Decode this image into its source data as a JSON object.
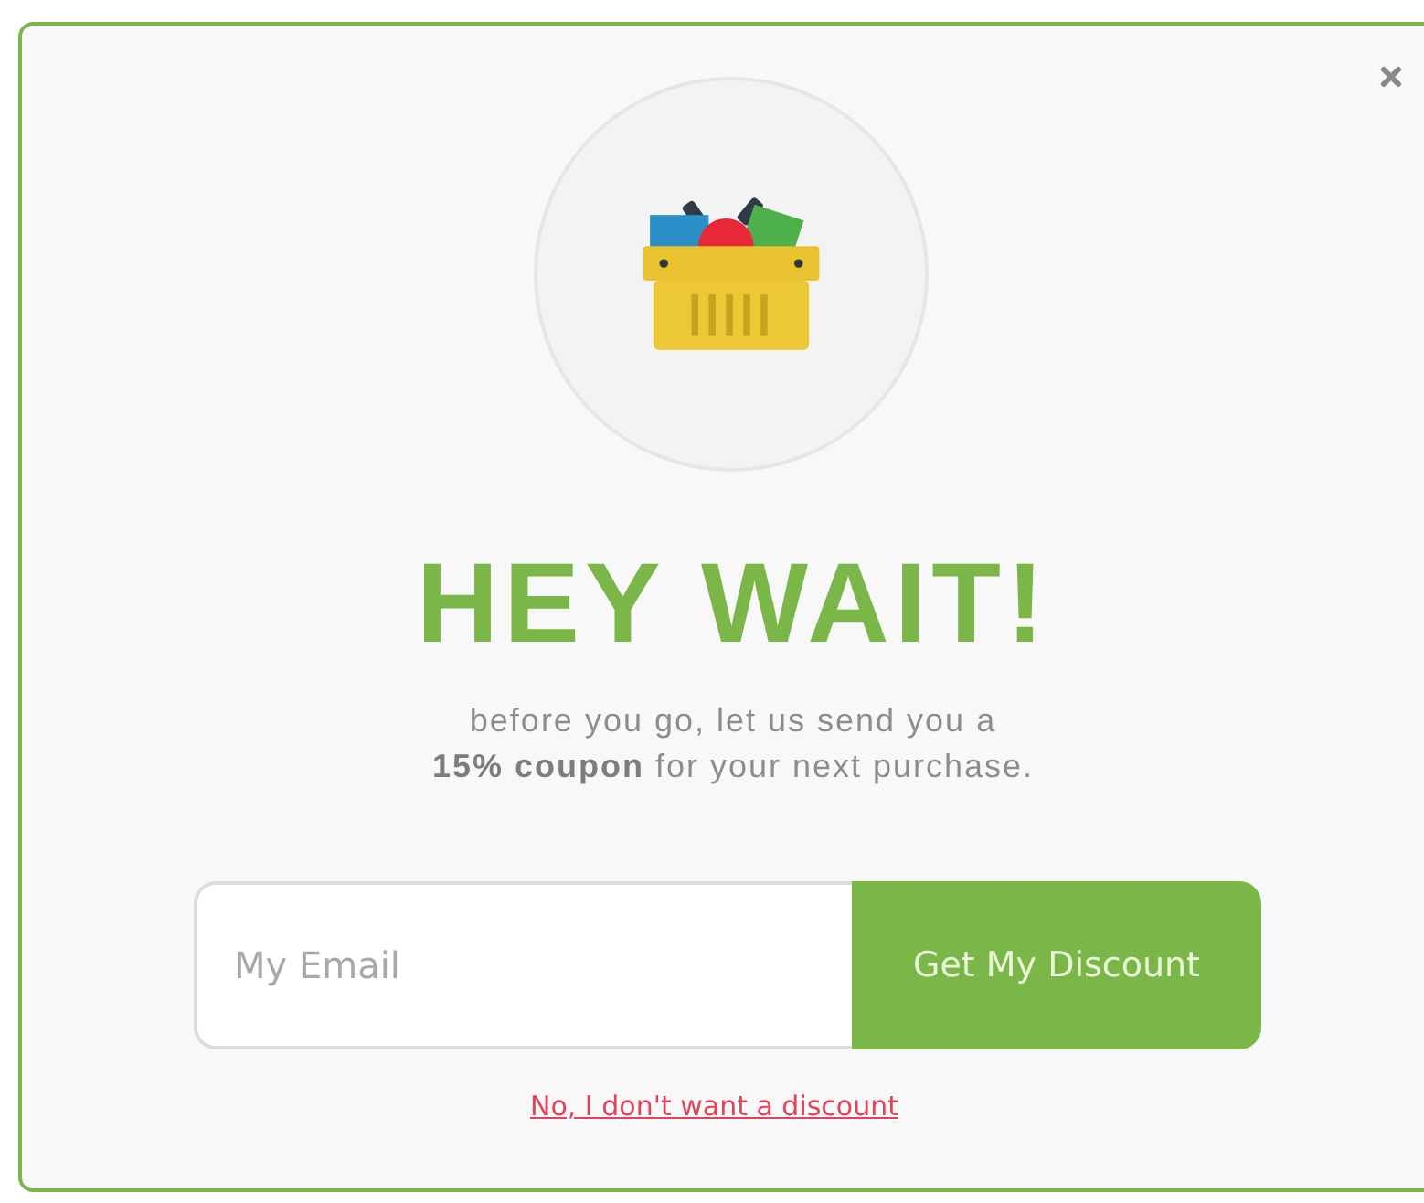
{
  "popup": {
    "title": "HEY WAIT!",
    "message": "before you go, let us send you a\n**15% coupon** for your next purchase.",
    "email": {
      "placeholder": "My Email"
    },
    "submit": "Get My Discount",
    "decline": "No, I don't want a discount"
  }
}
